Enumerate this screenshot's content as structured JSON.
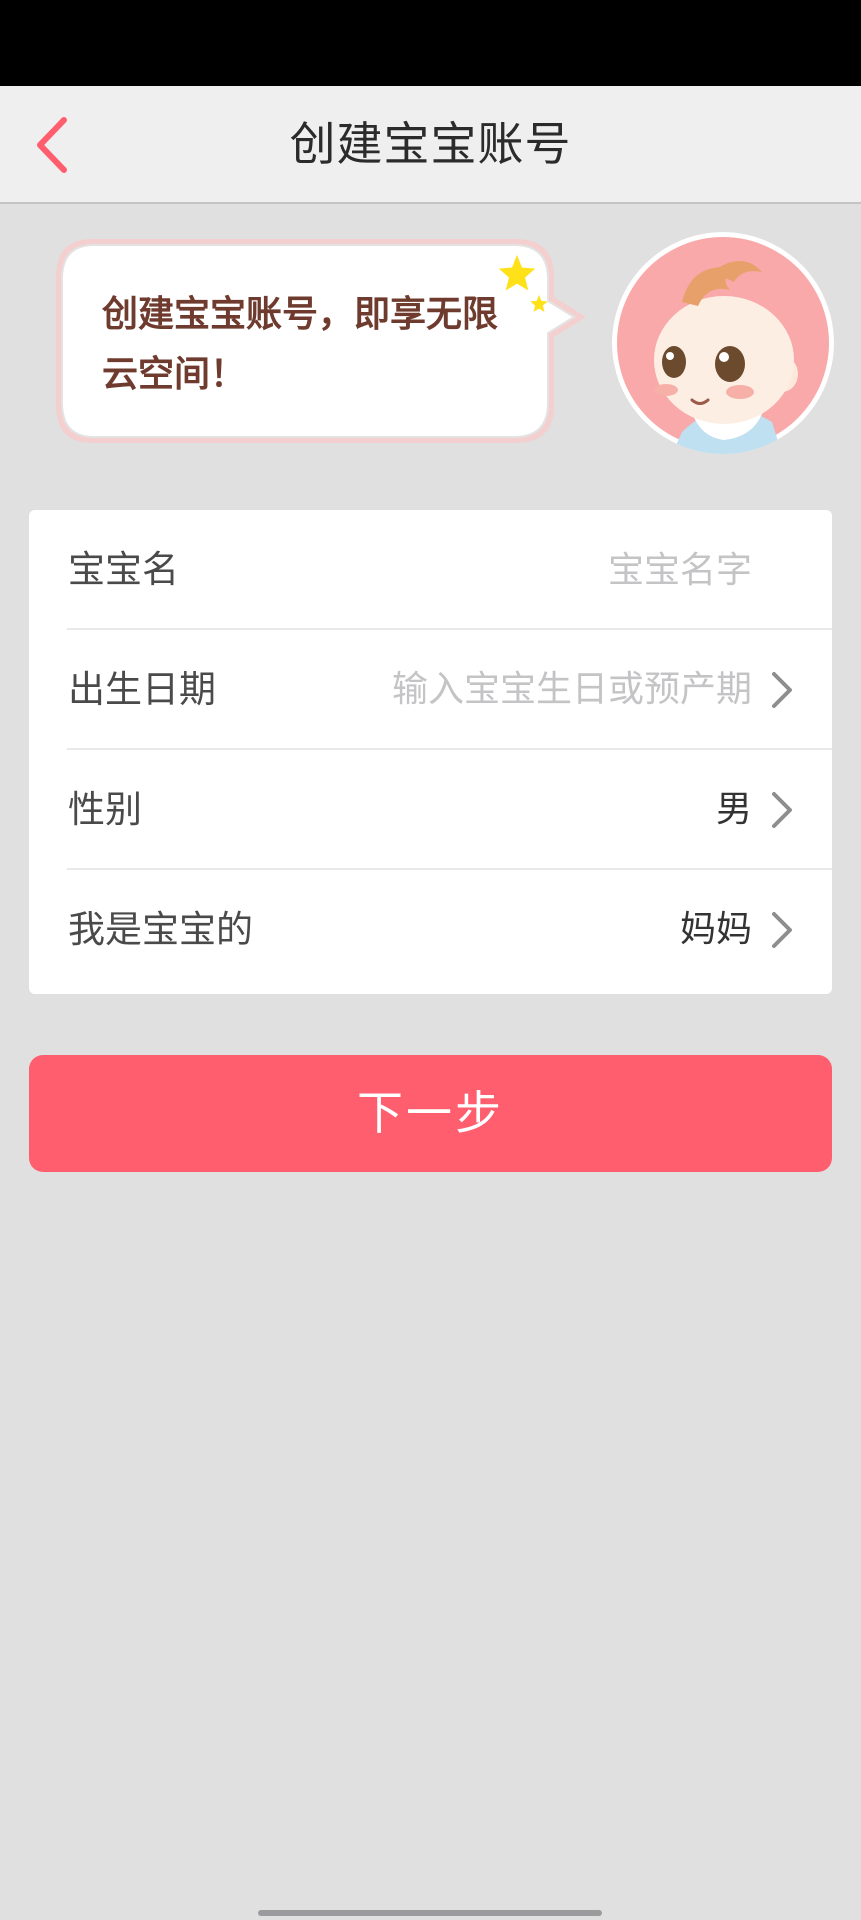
{
  "header": {
    "title": "创建宝宝账号",
    "back_icon": "chevron-left-icon",
    "accent_color": "#ff5e6f"
  },
  "banner": {
    "message": "创建宝宝账号，即享无限云空间！",
    "avatar": "baby-avatar"
  },
  "form": {
    "name": {
      "label": "宝宝名",
      "placeholder": "宝宝名字",
      "value": ""
    },
    "birth": {
      "label": "出生日期",
      "placeholder": "输入宝宝生日或预产期",
      "icon": "chevron-right-icon"
    },
    "gender": {
      "label": "性别",
      "value": "男",
      "icon": "chevron-right-icon"
    },
    "relation": {
      "label": "我是宝宝的",
      "value": "妈妈",
      "icon": "chevron-right-icon"
    }
  },
  "actions": {
    "next_label": "下一步",
    "button_color": "#ff5e6f"
  }
}
